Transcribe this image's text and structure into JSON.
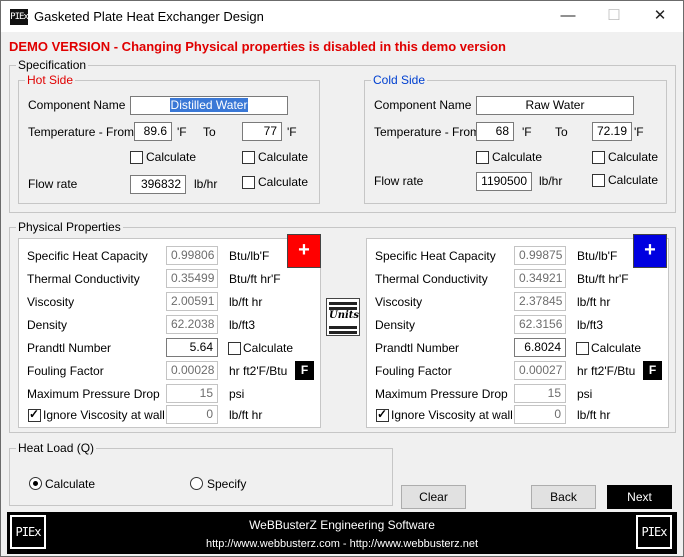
{
  "window": {
    "title": "Gasketed Plate Heat Exchanger Design",
    "icon_name": "plex-app-icon",
    "minimize_glyph": "—",
    "maximize_glyph": "☐",
    "close_glyph": "✕"
  },
  "demo_banner": "DEMO VERSION - Changing Physical properties is disabled in this demo version",
  "specification": {
    "title": "Specification",
    "hot": {
      "title": "Hot Side",
      "component_label": "Component Name",
      "component_value": "Distilled Water",
      "temp_label": "Temperature - From",
      "temp_from": "89.6",
      "temp_unit_from": "'F",
      "to_label": "To",
      "temp_to": "77",
      "temp_unit_to": "'F",
      "calc_from_label": "Calculate",
      "calc_to_label": "Calculate",
      "flow_label": "Flow rate",
      "flow_value": "396832",
      "flow_unit": "lb/hr",
      "calc_flow_label": "Calculate"
    },
    "cold": {
      "title": "Cold Side",
      "component_label": "Component Name",
      "component_value": "Raw Water",
      "temp_label": "Temperature - From",
      "temp_from": "68",
      "temp_unit_from": "'F",
      "to_label": "To",
      "temp_to": "72.19",
      "temp_unit_to": "'F",
      "calc_from_label": "Calculate",
      "calc_to_label": "Calculate",
      "flow_label": "Flow rate",
      "flow_value": "1190500",
      "flow_unit": "lb/hr",
      "calc_flow_label": "Calculate"
    }
  },
  "physical": {
    "title": "Physical Properties",
    "units_icon_label": "Units",
    "hot": {
      "plus_label": "+",
      "accent": "#ff0000",
      "rows": [
        {
          "label": "Specific Heat Capacity",
          "value": "0.99806",
          "unit": "Btu/lb'F"
        },
        {
          "label": "Thermal Conductivity",
          "value": "0.35499",
          "unit": "Btu/ft hr'F"
        },
        {
          "label": "Viscosity",
          "value": "2.00591",
          "unit": "lb/ft hr"
        },
        {
          "label": "Density",
          "value": "62.2038",
          "unit": "lb/ft3"
        },
        {
          "label": "Prandtl Number",
          "value": "5.64",
          "calc": "Calculate"
        },
        {
          "label": "Fouling Factor",
          "value": "0.00028",
          "unit": "hr ft2'F/Btu",
          "button": "F"
        },
        {
          "label": "Maximum Pressure Drop",
          "value": "15",
          "unit": "psi"
        },
        {
          "label": "Ignore Viscosity at wall",
          "value": "0",
          "unit": "lb/ft hr"
        }
      ]
    },
    "cold": {
      "plus_label": "+",
      "accent": "#0000e0",
      "rows": [
        {
          "label": "Specific Heat Capacity",
          "value": "0.99875",
          "unit": "Btu/lb'F"
        },
        {
          "label": "Thermal Conductivity",
          "value": "0.34921",
          "unit": "Btu/ft hr'F"
        },
        {
          "label": "Viscosity",
          "value": "2.37845",
          "unit": "lb/ft hr"
        },
        {
          "label": "Density",
          "value": "62.3156",
          "unit": "lb/ft3"
        },
        {
          "label": "Prandtl Number",
          "value": "6.8024",
          "calc": "Calculate"
        },
        {
          "label": "Fouling Factor",
          "value": "0.00027",
          "unit": "hr ft2'F/Btu",
          "button": "F"
        },
        {
          "label": "Maximum Pressure Drop",
          "value": "15",
          "unit": "psi"
        },
        {
          "label": "Ignore Viscosity at wall",
          "value": "0",
          "unit": "lb/ft hr"
        }
      ]
    }
  },
  "heat_load": {
    "title": "Heat Load (Q)",
    "calculate_label": "Calculate",
    "specify_label": "Specify"
  },
  "buttons": {
    "clear": "Clear",
    "back": "Back",
    "next": "Next"
  },
  "footer": {
    "company": "WeBBusterZ Engineering Software",
    "urls": "http://www.webbusterz.com - http://www.webbusterz.net",
    "logo_text": "PIEx"
  }
}
